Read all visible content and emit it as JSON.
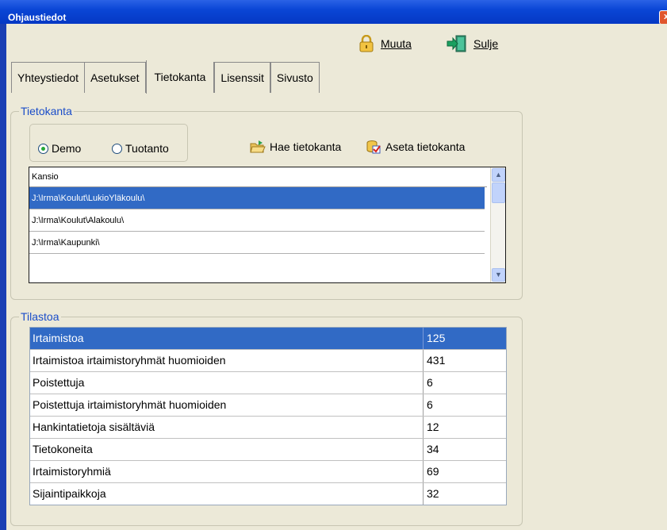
{
  "window": {
    "title": "Ohjaustiedot",
    "close_glyph": "x"
  },
  "toolbar": {
    "edit": {
      "label": "Muuta",
      "icon": "lock-icon"
    },
    "close": {
      "label": "Sulje",
      "icon": "exit-door-icon"
    }
  },
  "tabs": [
    "Yhteystiedot",
    "Asetukset",
    "Tietokanta",
    "Lisenssit",
    "Sivusto"
  ],
  "active_tab": "Tietokanta",
  "database": {
    "group_label": "Tietokanta",
    "radio_demo": "Demo",
    "radio_production": "Tuotanto",
    "selected_radio": "Demo",
    "fetch_label": "Hae tietokanta",
    "set_label": "Aseta tietokanta",
    "column_header": "Kansio",
    "folders": [
      "J:\\Irma\\Koulut\\LukioYläkoulu\\",
      "J:\\Irma\\Koulut\\Alakoulu\\",
      "J:\\Irma\\Kaupunki\\",
      ""
    ]
  },
  "statistics": {
    "group_label": "Tilastoa",
    "rows": [
      {
        "name": "Irtaimistoa",
        "value": "125"
      },
      {
        "name": "Irtaimistoa irtaimistoryhmät huomioiden",
        "value": "431"
      },
      {
        "name": "Poistettuja",
        "value": "6"
      },
      {
        "name": "Poistettuja irtaimistoryhmät huomioiden",
        "value": "6"
      },
      {
        "name": "Hankintatietoja sisältäviä",
        "value": "12"
      },
      {
        "name": "Tietokoneita",
        "value": "34"
      },
      {
        "name": "Irtaimistoryhmiä",
        "value": "69"
      },
      {
        "name": "Sijaintipaikkoja",
        "value": "32"
      }
    ]
  },
  "colors": {
    "selection": "#316ac5",
    "group_label": "#1a4dc9",
    "window_bg": "#ece9d8"
  }
}
